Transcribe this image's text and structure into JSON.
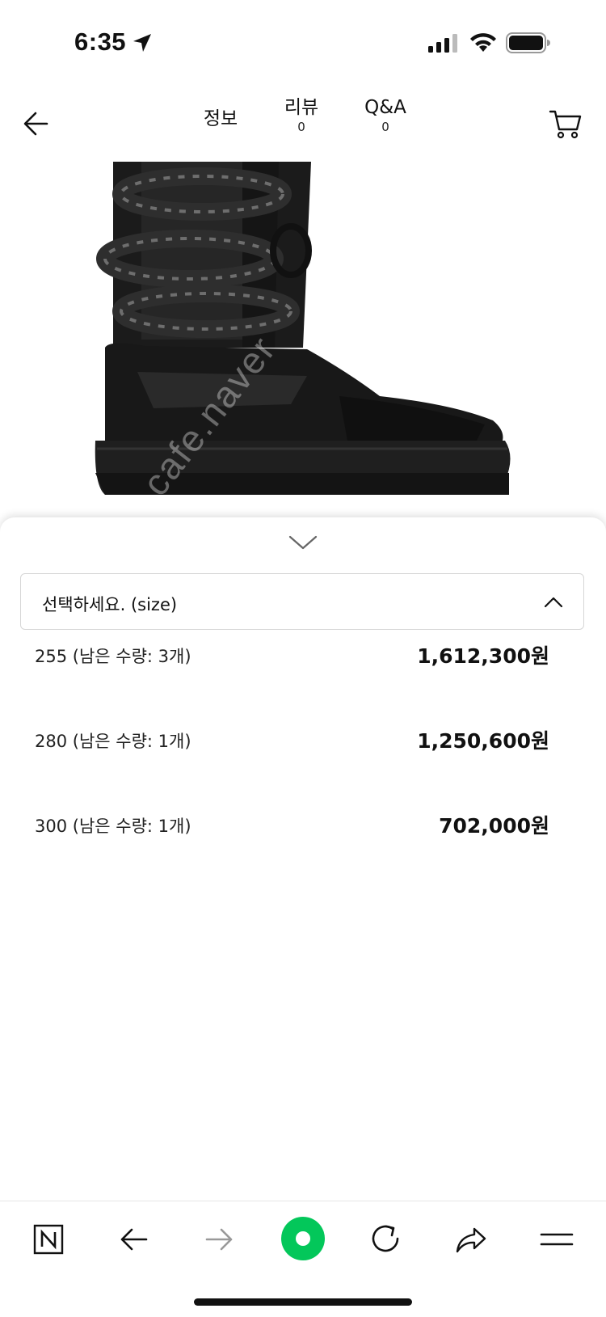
{
  "status_bar": {
    "time": "6:35",
    "icons": [
      "location-arrow-icon",
      "cellular-signal-icon",
      "wifi-icon",
      "battery-icon"
    ]
  },
  "header": {
    "back_icon": "arrow-left-icon",
    "tabs": [
      {
        "label": "정보",
        "count": ""
      },
      {
        "label": "리뷰",
        "count": "0"
      },
      {
        "label": "Q&A",
        "count": "0"
      }
    ],
    "cart_icon": "cart-icon"
  },
  "product_image": {
    "description_icon": "boot-image",
    "watermark": "cafe.naver"
  },
  "option_sheet": {
    "collapse_icon": "chevron-down-icon",
    "select_placeholder": "선택하세요. (size)",
    "select_icon": "chevron-up-icon",
    "options": [
      {
        "label": "255 (남은 수량: 3개)",
        "price": "1,612,300원"
      },
      {
        "label": "280 (남은 수량: 1개)",
        "price": "1,250,600원"
      },
      {
        "label": "300 (남은 수량: 1개)",
        "price": "702,000원"
      }
    ]
  },
  "browser_toolbar": {
    "items": [
      "naver-n-icon",
      "back-arrow-icon",
      "forward-arrow-icon",
      "green-dot-icon",
      "refresh-icon",
      "share-icon",
      "menu-icon"
    ],
    "accent_color": "#03c75a"
  }
}
